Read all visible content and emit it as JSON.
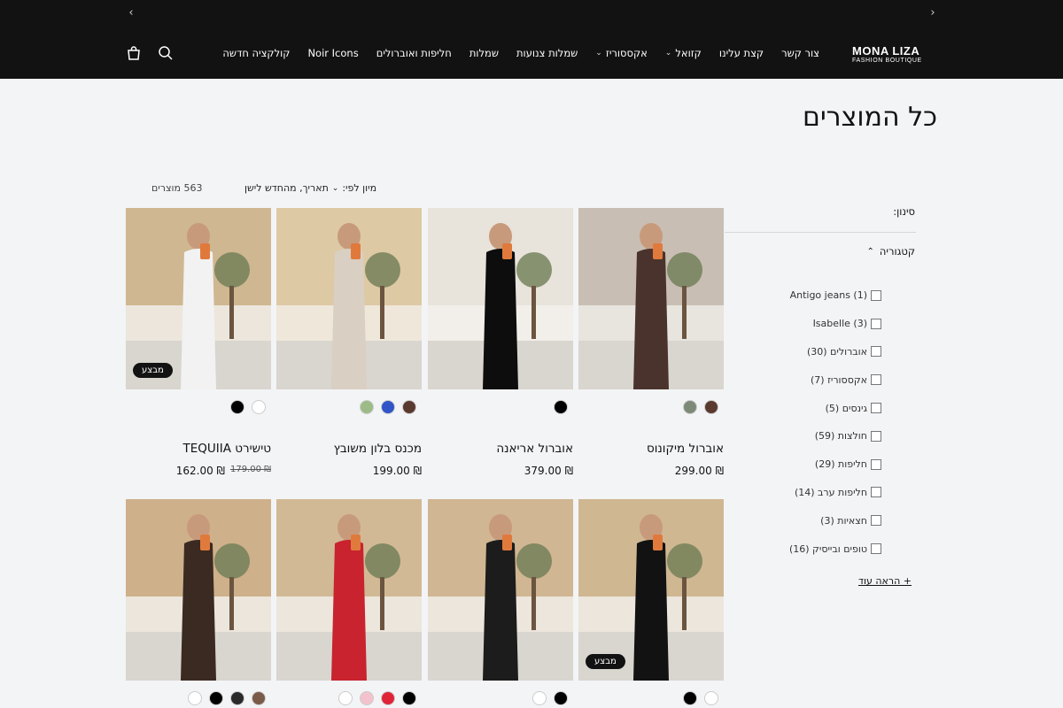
{
  "header": {
    "brand_line1": "MONA LIZA",
    "brand_line2": "FASHION BOUTIQUE",
    "nav": [
      {
        "label": "קולקציה חדשה",
        "dropdown": false
      },
      {
        "label": "Noir Icons",
        "dropdown": false
      },
      {
        "label": "חליפות ואוברולים",
        "dropdown": false
      },
      {
        "label": "שמלות",
        "dropdown": false
      },
      {
        "label": "שמלות צנועות",
        "dropdown": false
      },
      {
        "label": "אקססוריז",
        "dropdown": true
      },
      {
        "label": "קזואל",
        "dropdown": true
      },
      {
        "label": "קצת עלינו",
        "dropdown": false
      },
      {
        "label": "צור קשר",
        "dropdown": false
      }
    ],
    "icons": [
      "search-icon",
      "cart-icon"
    ],
    "prev_arrow": "‹",
    "next_arrow": "›"
  },
  "page": {
    "title": "כל המוצרים",
    "sort_label": "מיון לפי:",
    "sort_value": "תאריך, מהחדש לישן",
    "count": "563 מוצרים"
  },
  "filters": {
    "label": "סינון:",
    "category_heading": "קטגוריה",
    "categories": [
      "Antigo jeans (1)",
      "Isabelle (3)",
      "אוברולים (30)",
      "אקססוריז (7)",
      "גינסים (5)",
      "חולצות (59)",
      "חליפות (29)",
      "חליפות ערב (14)",
      "חצאיות (3)",
      "טופים ובייסיק (16)"
    ],
    "show_more": "+ הראה עוד"
  },
  "badge_label": "מבצע",
  "products": [
    {
      "name": "אוברול מיקונוס",
      "price": "₪ 299.00",
      "old_price": "",
      "badge": false,
      "swatches": [
        "#5a3a2e",
        "#7d8a78"
      ]
    },
    {
      "name": "אוברול אריאנה",
      "price": "₪ 379.00",
      "old_price": "",
      "badge": false,
      "swatches": [
        "#000000"
      ]
    },
    {
      "name": "מכנס בלון משובץ",
      "price": "₪ 199.00",
      "old_price": "",
      "badge": false,
      "swatches": [
        "#5a3a2e",
        "#2f55c7",
        "#9dbb86"
      ]
    },
    {
      "name": "טישירט TEQUIIA",
      "price": "₪ 162.00",
      "old_price": "₪ 179.00",
      "badge": true,
      "swatches": [
        "#ffffff",
        "#000000"
      ]
    },
    {
      "name": "",
      "price": "",
      "old_price": "",
      "badge": true,
      "swatches": [
        "#ffffff",
        "#000000"
      ]
    },
    {
      "name": "",
      "price": "",
      "old_price": "",
      "badge": false,
      "swatches": [
        "#000000",
        "#ffffff"
      ]
    },
    {
      "name": "",
      "price": "",
      "old_price": "",
      "badge": false,
      "swatches": [
        "#000000",
        "#e02438",
        "#f3c2cc",
        "#ffffff"
      ]
    },
    {
      "name": "",
      "price": "",
      "old_price": "",
      "badge": false,
      "swatches": [
        "#7a5a48",
        "#2a2a2a",
        "#000000",
        "#ffffff"
      ]
    }
  ]
}
